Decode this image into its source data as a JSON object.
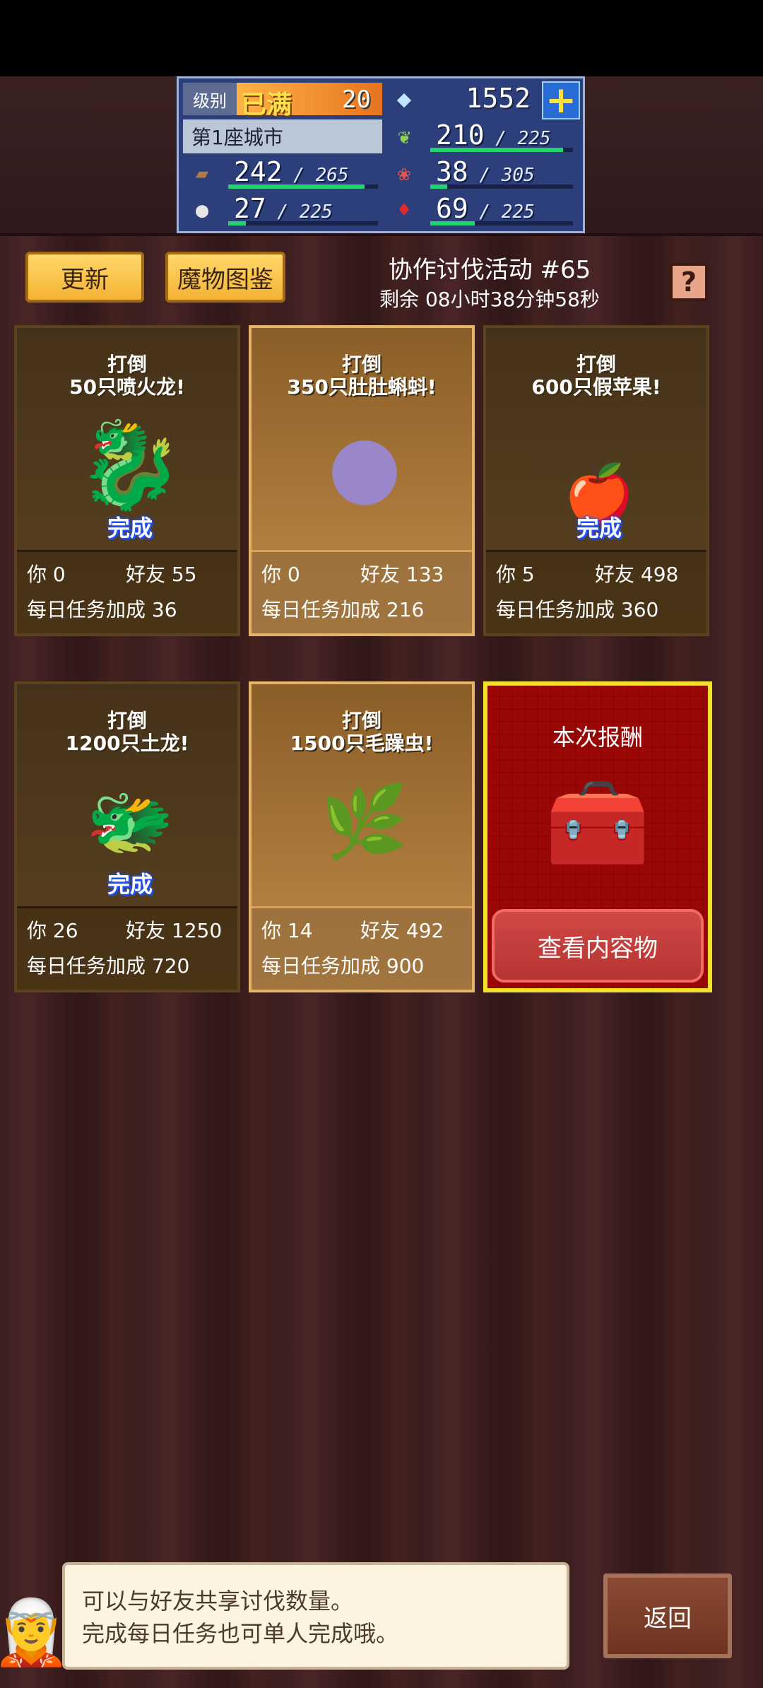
{
  "status": {
    "level_label": "级别",
    "level_max": "已满",
    "level": "20",
    "gems": "1552",
    "plus_icon": "plus-icon",
    "city": "第1座城市",
    "resources": [
      {
        "icon": "leaf-icon",
        "value": "210",
        "max": "225",
        "fill": 0.93
      },
      {
        "icon": "log-icon",
        "value": "242",
        "max": "265",
        "fill": 0.91
      },
      {
        "icon": "food-icon",
        "value": "38",
        "max": "305",
        "fill": 0.12
      },
      {
        "icon": "stone-icon",
        "value": "27",
        "max": "225",
        "fill": 0.12
      },
      {
        "icon": "ruby-icon",
        "value": "69",
        "max": "225",
        "fill": 0.31
      }
    ]
  },
  "header": {
    "refresh": "更新",
    "monster_book": "魔物图鉴",
    "event_title": "协作讨伐活动 #65",
    "remaining": "剩余 08小时38分钟58秒",
    "help": "?"
  },
  "cards": [
    {
      "line1": "打倒",
      "line2": "50只喷火龙!",
      "done": "完成",
      "you": "你 0",
      "friend": "好友 55",
      "bonus": "每日任务加成  36",
      "monster": "fire-dragon-icon"
    },
    {
      "line1": "打倒",
      "line2": "350只肚肚蝌蚪!",
      "done": "",
      "you": "你 0",
      "friend": "好友 133",
      "bonus": "每日任务加成  216",
      "monster": "tadpole-icon"
    },
    {
      "line1": "打倒",
      "line2": "600只假苹果!",
      "done": "完成",
      "you": "你 5",
      "friend": "好友 498",
      "bonus": "每日任务加成  360",
      "monster": "fake-apple-icon"
    },
    {
      "line1": "打倒",
      "line2": "1200只土龙!",
      "done": "完成",
      "you": "你 26",
      "friend": "好友 1250",
      "bonus": "每日任务加成  720",
      "monster": "earth-dragon-icon"
    },
    {
      "line1": "打倒",
      "line2": "1500只毛躁虫!",
      "done": "",
      "you": "你 14",
      "friend": "好友 492",
      "bonus": "每日任务加成  900",
      "monster": "bug-icon"
    }
  ],
  "reward": {
    "title": "本次报酬",
    "view_button": "查看内容物",
    "icon": "treasure-chest-icon"
  },
  "tip": {
    "line1": "可以与好友共享讨伐数量。",
    "line2": "完成每日任务也可单人完成哦。"
  },
  "back": "返回"
}
